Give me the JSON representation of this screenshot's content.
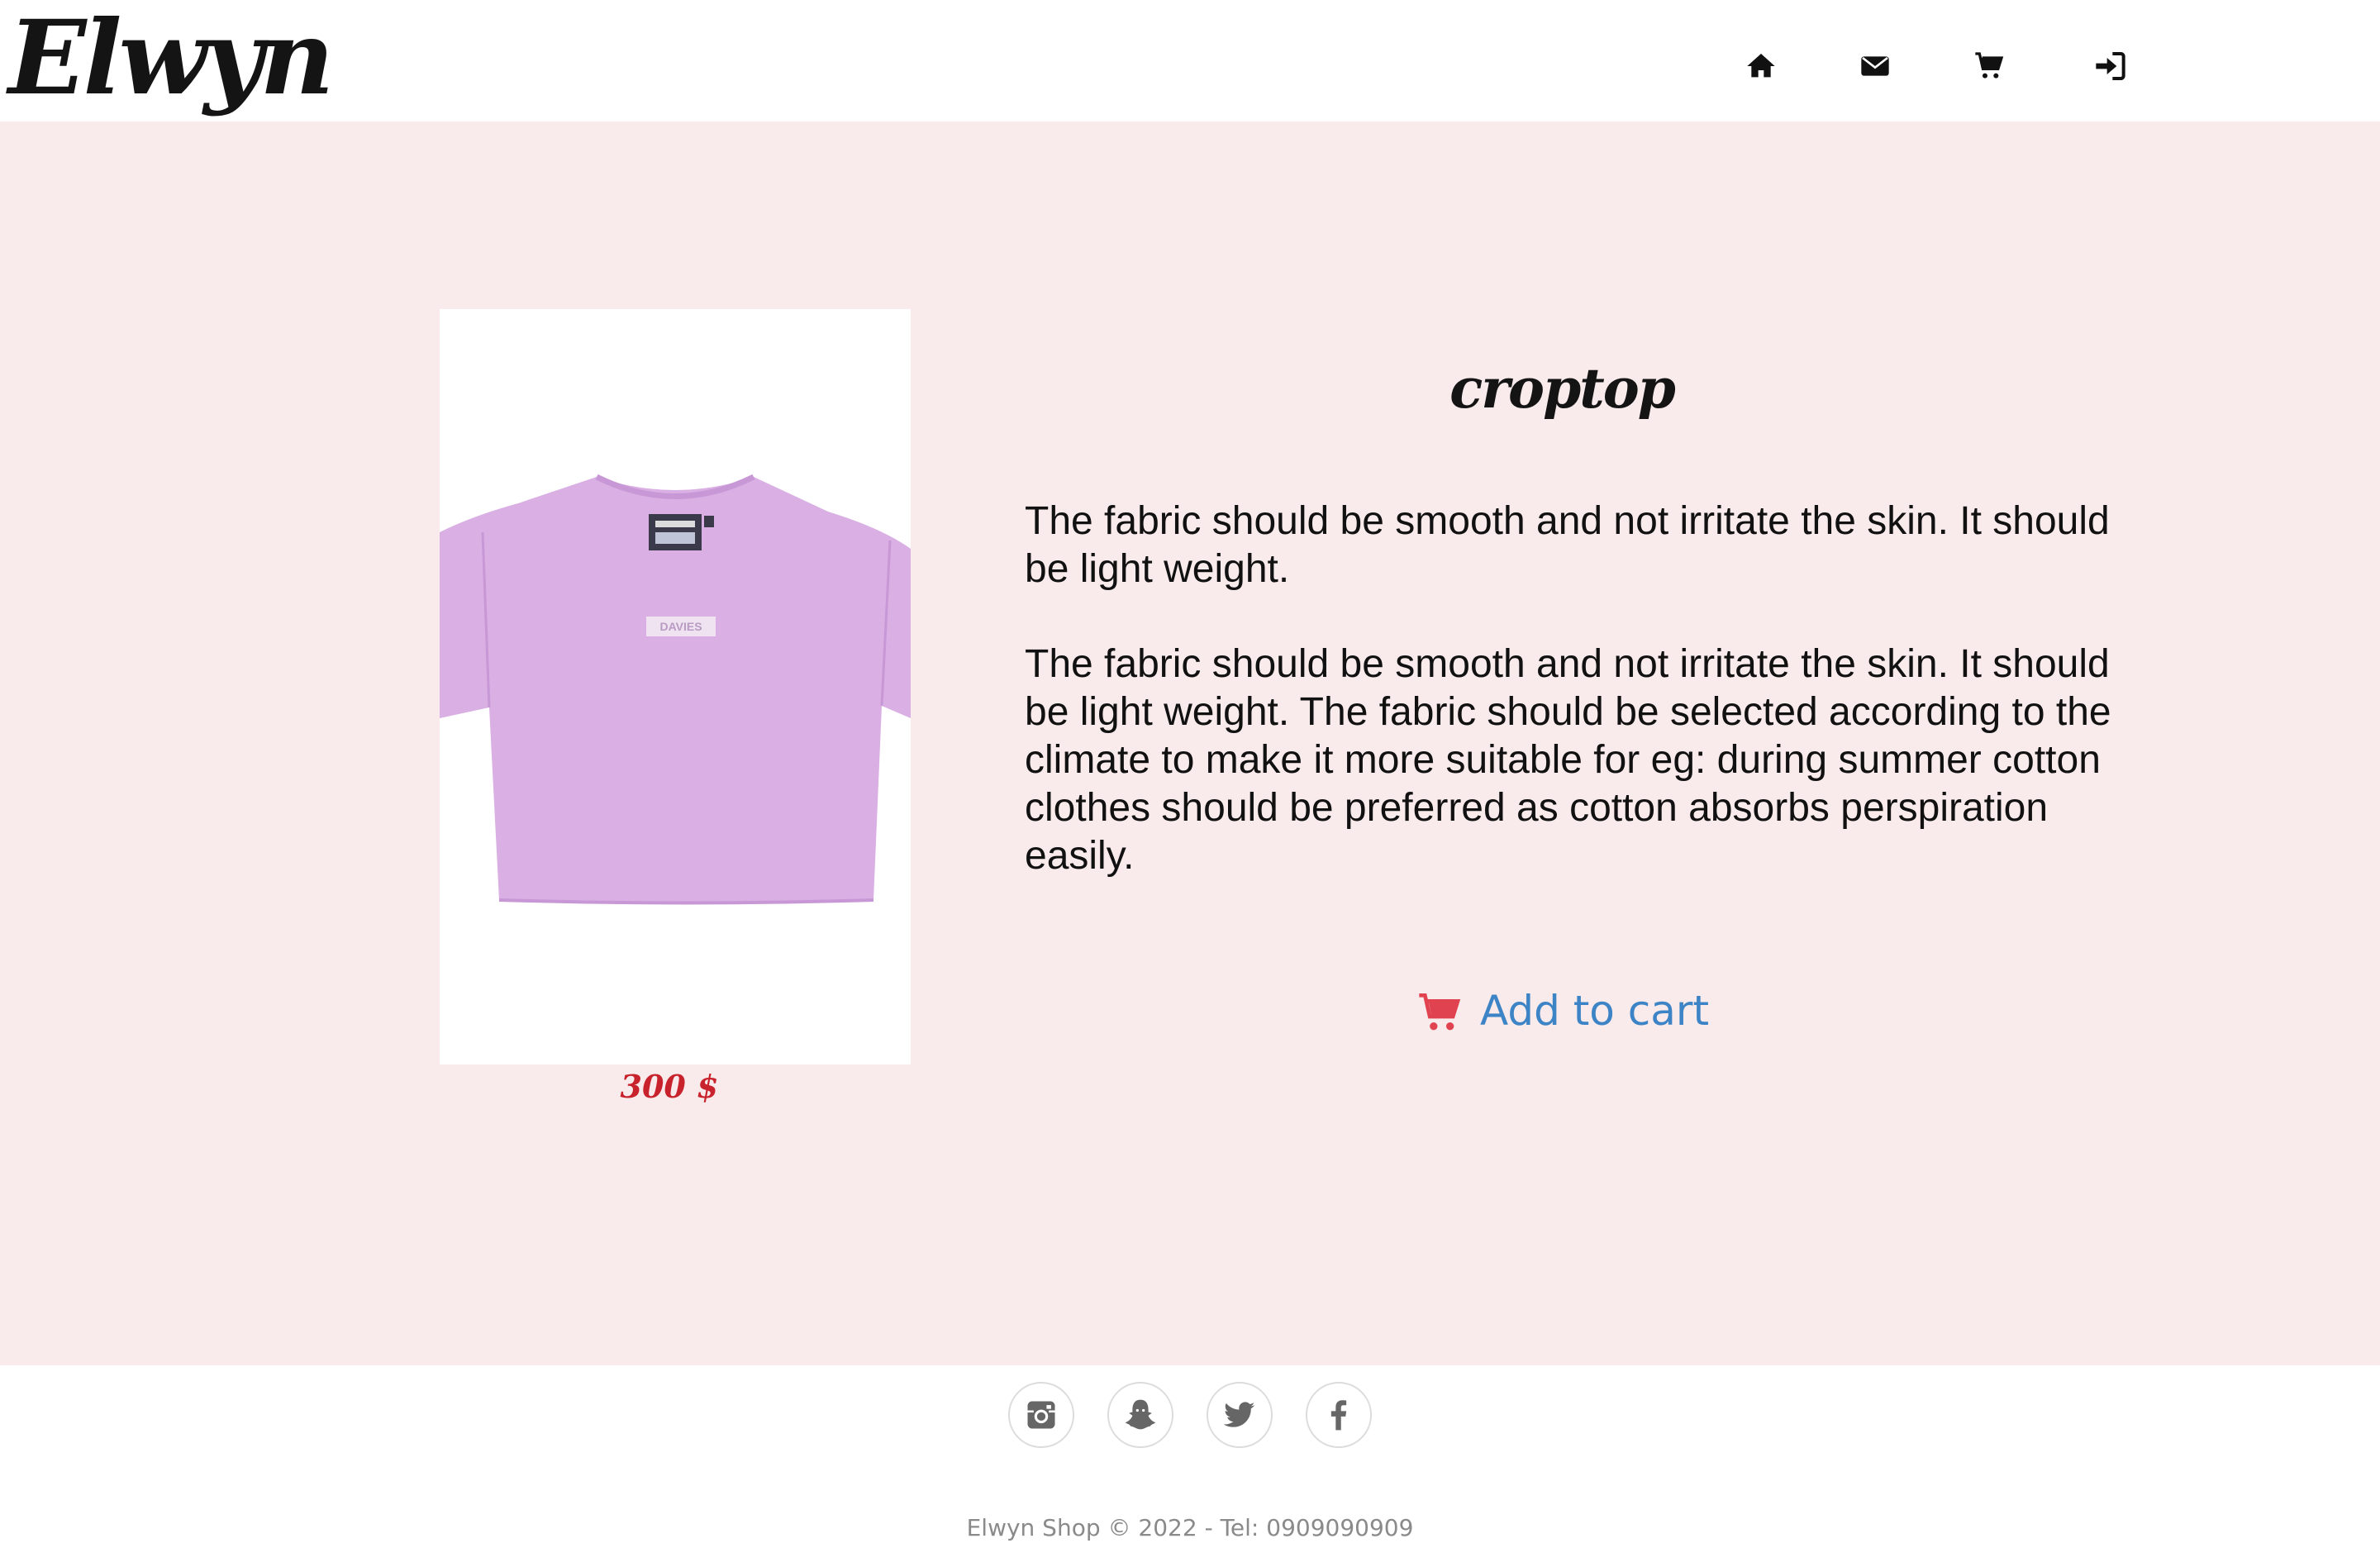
{
  "header": {
    "logo": "Elwyn",
    "nav": [
      {
        "icon": "home-icon"
      },
      {
        "icon": "envelope-icon"
      },
      {
        "icon": "cart-icon"
      },
      {
        "icon": "sign-in-icon"
      }
    ]
  },
  "product": {
    "title": "croptop",
    "price": "300 $",
    "image_print": "DAVIES",
    "description_1": "The fabric should be smooth and not irritate the skin. It should be light weight.",
    "description_2": "The fabric should be smooth and not irritate the skin. It should be light weight. The fabric should be selected according to the climate to make it more suitable for eg: during summer cotton clothes should be preferred as cotton absorbs perspiration easily.",
    "add_to_cart_label": "Add to cart"
  },
  "footer": {
    "social": [
      {
        "icon": "instagram-icon"
      },
      {
        "icon": "snapchat-icon"
      },
      {
        "icon": "twitter-icon"
      },
      {
        "icon": "facebook-icon"
      }
    ],
    "copyright": "Elwyn Shop © 2022 - Tel: 0909090909"
  },
  "colors": {
    "main_background": "#f9ebeb",
    "price": "#c8232c",
    "link": "#3d84c6",
    "cart_icon": "#e0434f",
    "shirt": "#d9afe4"
  }
}
